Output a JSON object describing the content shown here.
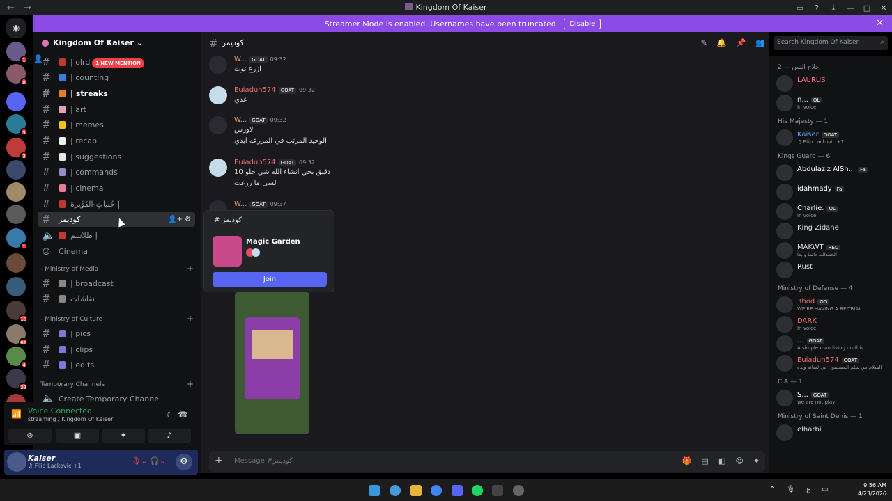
{
  "window": {
    "title": "Kingdom Of Kaiser"
  },
  "banner": {
    "text": "Streamer Mode is enabled. Usernames have been truncated.",
    "button": "Disable"
  },
  "server": {
    "name": "Kingdom Of Kaiser"
  },
  "mention_badge": "1 NEW MENTION",
  "servers": [
    {
      "badge": "1"
    },
    {
      "badge": "8"
    },
    {
      "badge": ""
    },
    {
      "badge": "5"
    },
    {
      "badge": "3"
    },
    {
      "badge": ""
    },
    {
      "badge": ""
    },
    {
      "badge": ""
    },
    {
      "badge": "1"
    },
    {
      "badge": ""
    },
    {
      "badge": ""
    },
    {
      "badge": "18"
    },
    {
      "badge": "62"
    },
    {
      "badge": "4"
    },
    {
      "badge": "22"
    },
    {
      "badge": "35"
    }
  ],
  "channels": [
    {
      "name": "| olrd",
      "color": "#c0392b"
    },
    {
      "name": "| counting",
      "color": "#3b7dd8"
    },
    {
      "name": "| streaks",
      "color": "#e67e22"
    },
    {
      "name": "| art",
      "color": "#e8a0b4"
    },
    {
      "name": "| memes",
      "color": "#f1c40f"
    },
    {
      "name": "| recap",
      "color": "#ecf0f1"
    },
    {
      "name": "| suggestions",
      "color": "#e8e8e8"
    },
    {
      "name": "| commands",
      "color": "#8e8ec8"
    },
    {
      "name": "| cinema",
      "color": "#e87d9a"
    },
    {
      "name": "حُلياتِ-الفَوِّيرة |",
      "color": "#c0392b"
    },
    {
      "name": "كوديمز",
      "color": ""
    },
    {
      "name": "طلاسم |",
      "color": "#c0392b"
    },
    {
      "name": "Cinema",
      "color": ""
    }
  ],
  "categories": {
    "media": "- Ministry of Media",
    "culture": "- Ministry of Culture",
    "temp": "Temporary Channels"
  },
  "media_channels": [
    {
      "name": "| broadcast"
    },
    {
      "name": "نقاشات"
    }
  ],
  "culture_channels": [
    {
      "name": "| pics"
    },
    {
      "name": "| clips"
    },
    {
      "name": "| edits"
    }
  ],
  "temp_channel": "Create Temporary Channel",
  "voice": {
    "status": "Voice Connected",
    "sub": "streaming / Kingdom Of Kaiser"
  },
  "user": {
    "name": "Kaiser",
    "status": "♫ Filip Lackovic +1"
  },
  "chat": {
    "channel": "كوديمز",
    "placeholder": "Message #كوديمز",
    "messages": [
      {
        "name": "W...",
        "tag": "GOAT",
        "time": "09:32",
        "lines": [
          "ازرع توت"
        ]
      },
      {
        "name": "Euiaduh574",
        "tag": "GOAT",
        "time": "09:32",
        "lines": [
          "عدي"
        ]
      },
      {
        "name": "W...",
        "tag": "GOAT",
        "time": "09:32",
        "lines": [
          "لاورس",
          "الوحيد المرتب في المزرعه ايدي"
        ]
      },
      {
        "name": "Euiaduh574",
        "tag": "GOAT",
        "time": "09:32",
        "lines": [
          "10 دقيق بجي انشاء الله شي حلو",
          "لسى ما زرعت"
        ]
      },
      {
        "name": "W...",
        "tag": "GOAT",
        "time": "09:37",
        "lines": []
      }
    ]
  },
  "activity": {
    "channel": "كوديمز",
    "game": "Magic Garden",
    "join": "Join"
  },
  "search": {
    "placeholder": "Search Kingdom Of Kaiser"
  },
  "members": [
    {
      "group": "حلاج النس — 2",
      "items": [
        {
          "name": "LAURUS",
          "status": "",
          "color": "#ff6b8a"
        },
        {
          "name": "n...",
          "status": "In voice",
          "color": "#dbdee1",
          "tag": "OL"
        }
      ]
    },
    {
      "group": "His Majesty — 1",
      "items": [
        {
          "name": "Kaiser",
          "status": "♫ Filip Lackovic +1",
          "color": "#5aa0ff",
          "tag": "GOAT"
        }
      ]
    },
    {
      "group": "Kings Guard — 6",
      "items": [
        {
          "name": "Abdulaziz AlSh...",
          "status": "",
          "color": "#fff",
          "tag": "Fa"
        },
        {
          "name": "idahmady",
          "status": "",
          "color": "#fff",
          "tag": "Fa"
        },
        {
          "name": "Charlie.",
          "status": "In voice",
          "color": "#fff",
          "tag": "OL"
        },
        {
          "name": "King Zidane",
          "status": "",
          "color": "#dbdee1"
        },
        {
          "name": "MAKWT",
          "status": "الحمدالله دائما وابدا",
          "color": "#dbdee1",
          "tag": "RED"
        },
        {
          "name": "Rust",
          "status": "",
          "color": "#dbdee1"
        }
      ]
    },
    {
      "group": "Ministry of Defense — 4",
      "items": [
        {
          "name": "3bod",
          "status": "WE'RE HAVING A RE-TRIAL",
          "color": "#e86b6b",
          "tag": "OG"
        },
        {
          "name": "DARK",
          "status": "In voice",
          "color": "#e86b6b"
        },
        {
          "name": "...",
          "status": "A simple man living on this...",
          "color": "#dbdee1",
          "tag": "GOAT"
        },
        {
          "name": "Euiaduh574",
          "status": "السلام من سلم المسلمون من لسانه ويده",
          "color": "#e86b6b",
          "tag": "GOAT"
        }
      ]
    },
    {
      "group": "CIA — 1",
      "items": [
        {
          "name": "S...",
          "status": "we are not play",
          "color": "#fff",
          "tag": "GOAT"
        }
      ]
    },
    {
      "group": "Ministry of Saint Denis — 1",
      "items": [
        {
          "name": "elharbi",
          "status": "",
          "color": "#dbdee1"
        }
      ]
    }
  ],
  "taskbar": {
    "time": "9:56 AM",
    "date": "4/23/2026",
    "lang": "ع"
  }
}
